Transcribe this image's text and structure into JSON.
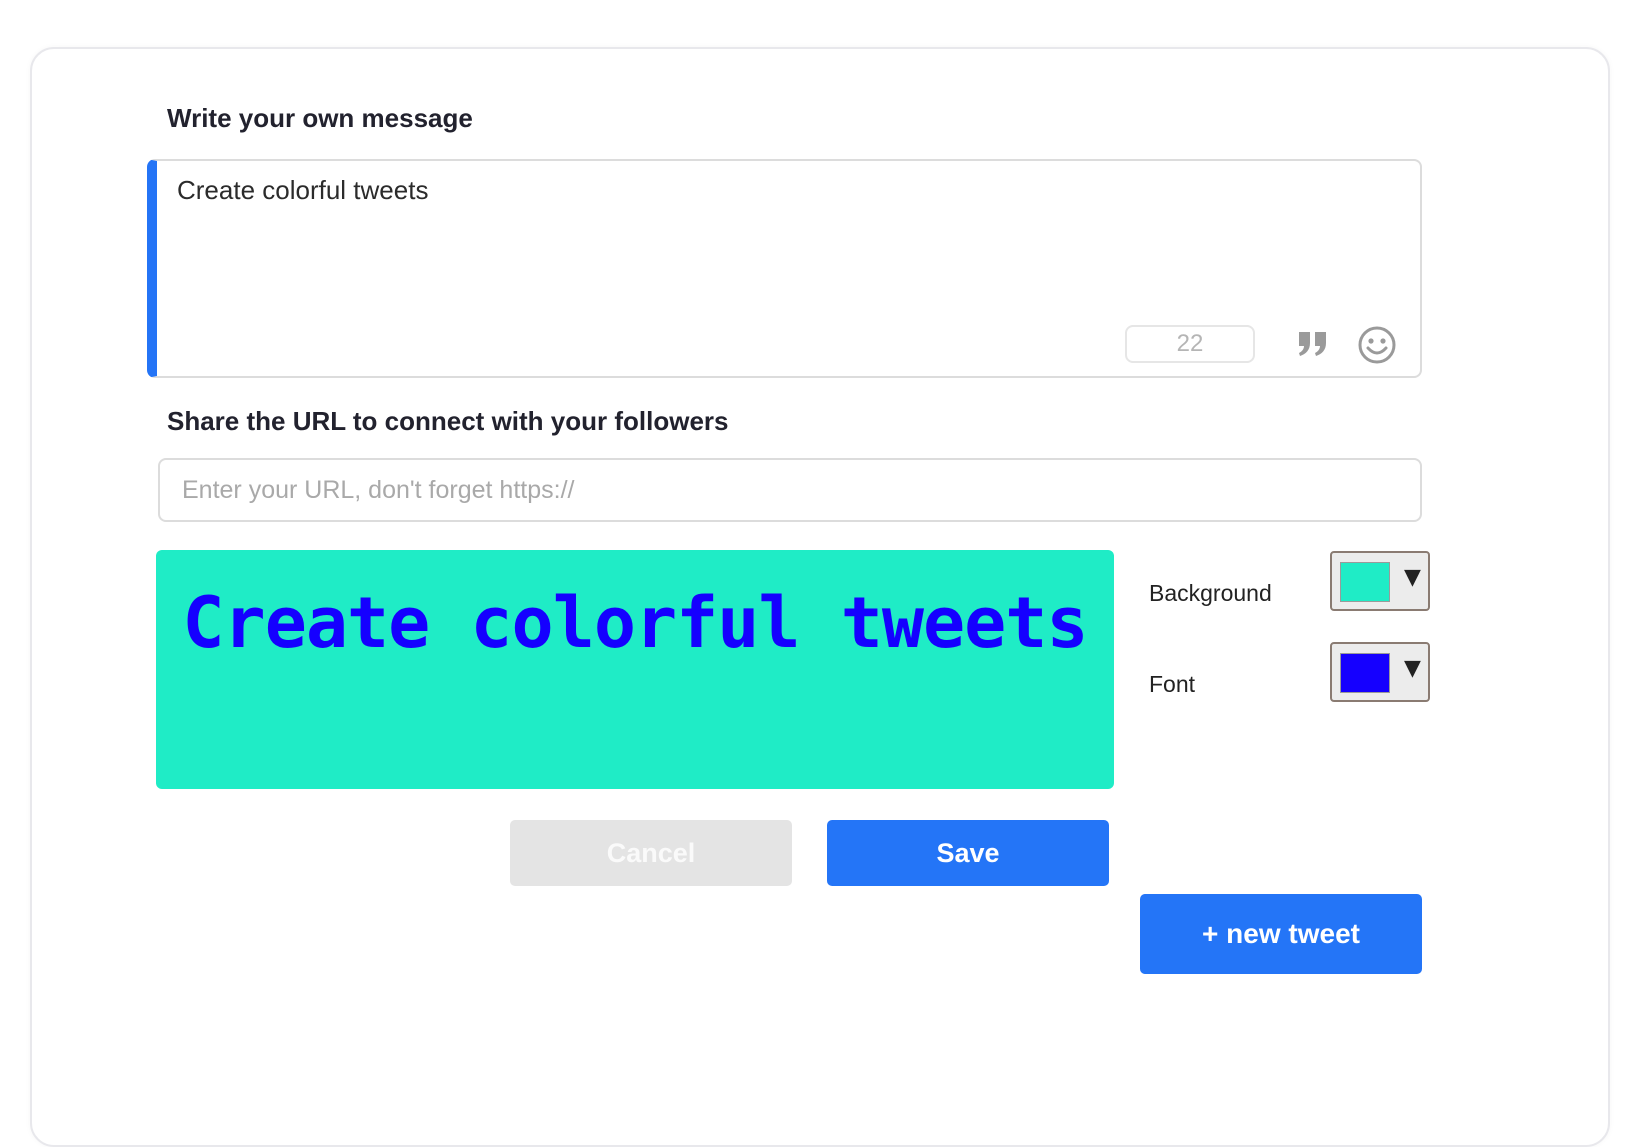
{
  "composer": {
    "message_label": "Write your own message",
    "message_text": "Create colorful tweets",
    "char_count": "22",
    "url_label": "Share the URL to connect with your followers",
    "url_placeholder": "Enter your URL, don't forget https://",
    "url_value": ""
  },
  "preview": {
    "text": "Create colorful tweets",
    "background_color": "#1fecc6",
    "font_color": "#1500ff"
  },
  "colors": {
    "background_label": "Background",
    "font_label": "Font",
    "background_swatch": "#1fecc6",
    "font_swatch": "#1500ff",
    "dropdown_icon": "▼"
  },
  "actions": {
    "cancel_label": "Cancel",
    "save_label": "Save",
    "new_tweet_label": "+ new tweet"
  },
  "icons": {
    "quote": "quote-icon",
    "emoji": "smiley-icon"
  },
  "theme": {
    "accent": "#2475f7",
    "border": "#dcdcdc",
    "disabled": "#e4e4e4"
  }
}
